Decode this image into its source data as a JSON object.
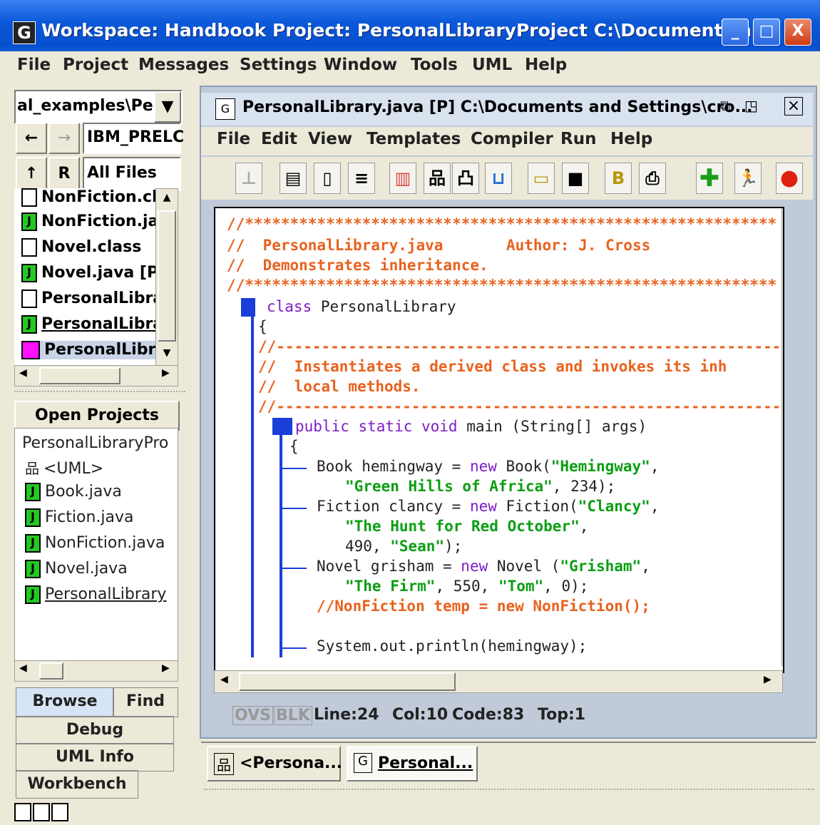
{
  "window": {
    "title": "Workspace: Handbook   Project: PersonalLibraryProject  C:\\Documents a...",
    "app_icon": "G",
    "buttons": {
      "minimize": "_",
      "maximize": "□",
      "close": "X"
    }
  },
  "menubar": [
    "File",
    "Project",
    "Messages",
    "Settings",
    "Window",
    "Tools",
    "UML",
    "Help"
  ],
  "browse": {
    "path": "al_examples\\Pers",
    "filter_name": "IBM_PRELC",
    "filter_files": "All Files",
    "r_label": "R",
    "files": [
      {
        "name": "NonFiction.cla",
        "icon": "class-file-icon"
      },
      {
        "name": "NonFiction.jav",
        "icon": "java-file-icon"
      },
      {
        "name": "Novel.class",
        "icon": "class-file-icon"
      },
      {
        "name": "Novel.java [P]",
        "icon": "java-file-icon"
      },
      {
        "name": "PersonalLibra",
        "icon": "class-file-icon"
      },
      {
        "name": "PersonalLibra",
        "icon": "java-file-icon"
      },
      {
        "name": "PersonalLibra",
        "icon": "project-file-icon"
      }
    ]
  },
  "open_projects": {
    "header": "Open Projects",
    "project": "PersonalLibraryPro",
    "items": [
      {
        "name": "<UML>",
        "icon": "uml-icon"
      },
      {
        "name": "Book.java",
        "icon": "java-file-icon"
      },
      {
        "name": "Fiction.java",
        "icon": "java-file-icon"
      },
      {
        "name": "NonFiction.java",
        "icon": "java-file-icon"
      },
      {
        "name": "Novel.java",
        "icon": "java-file-icon"
      },
      {
        "name": "PersonalLibrary",
        "icon": "java-file-icon"
      }
    ]
  },
  "left_tabs": {
    "browse": "Browse",
    "find": "Find",
    "debug": "Debug",
    "uml_info": "UML Info",
    "workbench": "Workbench"
  },
  "editor": {
    "title": "PersonalLibrary.java [P]  C:\\Documents and Settings\\cro...",
    "menu": [
      "File",
      "Edit",
      "View",
      "Templates",
      "Compiler",
      "Run",
      "Help"
    ],
    "code": [
      "//***********************************************************",
      "//  PersonalLibrary.java       Author: J. Cross",
      "//  Demonstrates inheritance.",
      "//***********************************************************",
      "class PersonalLibrary",
      "{",
      "//-----------------------------------------------------------",
      "//  Instantiates a derived class and invokes its inh",
      "//  local methods.",
      "//-----------------------------------------------------------",
      "public static void main (String[] args)",
      "{",
      "Book hemingway = new Book(\"Hemingway\",",
      "\"Green Hills of Africa\", 234);",
      "Fiction clancy = new Fiction(\"Clancy\",",
      "\"The Hunt for Red October\",",
      "490, \"Sean\");",
      "Novel grisham = new Novel (\"Grisham\",",
      "\"The Firm\", 550, \"Tom\", 0);",
      "//NonFiction temp = new NonFiction();",
      "System.out.println(hemingway);"
    ],
    "status": {
      "ovs": "OVS",
      "blk": "BLK",
      "line": "Line:24",
      "col": "Col:10",
      "code": "Code:83",
      "top": "Top:1"
    }
  },
  "doc_tabs": [
    "<Persona...",
    "Personal..."
  ],
  "colors": {
    "titlebar": "#0a58d8",
    "comment": "#e8621e",
    "keyword": "#7d1dc8",
    "string": "#0c9e13",
    "java_icon": "#23c823"
  }
}
